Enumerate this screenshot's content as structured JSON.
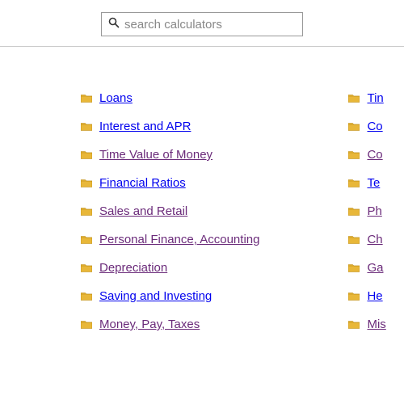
{
  "search": {
    "placeholder": "search calculators"
  },
  "categories": {
    "left": [
      {
        "label": "Loans",
        "visited": false
      },
      {
        "label": "Interest and APR",
        "visited": false
      },
      {
        "label": "Time Value of Money",
        "visited": true
      },
      {
        "label": "Financial Ratios",
        "visited": false
      },
      {
        "label": "Sales and Retail",
        "visited": true
      },
      {
        "label": "Personal Finance, Accounting",
        "visited": true
      },
      {
        "label": "Depreciation",
        "visited": true
      },
      {
        "label": "Saving and Investing",
        "visited": false
      },
      {
        "label": "Money, Pay, Taxes",
        "visited": true
      }
    ],
    "right": [
      {
        "label": "Tin",
        "visited": false
      },
      {
        "label": "Co",
        "visited": false
      },
      {
        "label": "Co",
        "visited": true
      },
      {
        "label": "Te",
        "visited": false
      },
      {
        "label": "Ph",
        "visited": true
      },
      {
        "label": "Ch",
        "visited": true
      },
      {
        "label": "Ga",
        "visited": true
      },
      {
        "label": "He",
        "visited": false
      },
      {
        "label": "Mis",
        "visited": true
      }
    ]
  }
}
